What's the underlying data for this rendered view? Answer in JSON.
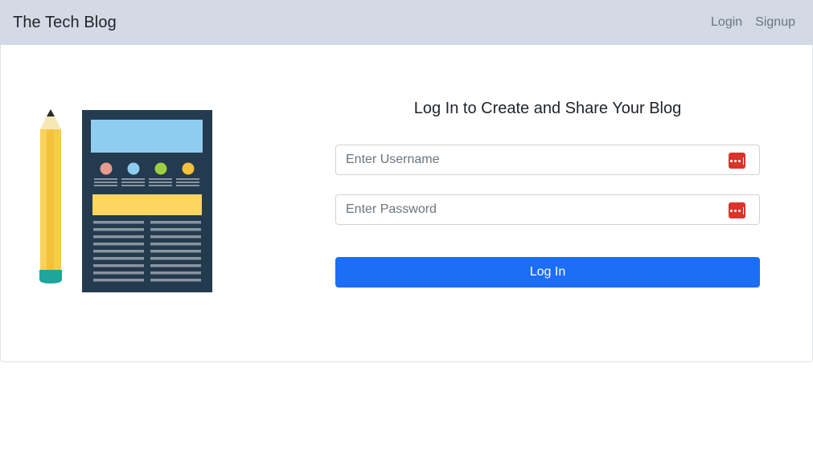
{
  "navbar": {
    "brand": "The Tech Blog",
    "links": [
      "Login",
      "Signup"
    ]
  },
  "login_form": {
    "title": "Log In to Create and Share Your Blog",
    "username_placeholder": "Enter Username",
    "password_placeholder": "Enter Password",
    "submit_label": "Log In"
  },
  "icons": {
    "field_icon": "password-manager-icon",
    "illustration": "pencil-and-document-illustration"
  },
  "colors": {
    "navbar_bg": "#d3dae5",
    "primary": "#1b6ef5",
    "field_icon": "#d9342b"
  }
}
